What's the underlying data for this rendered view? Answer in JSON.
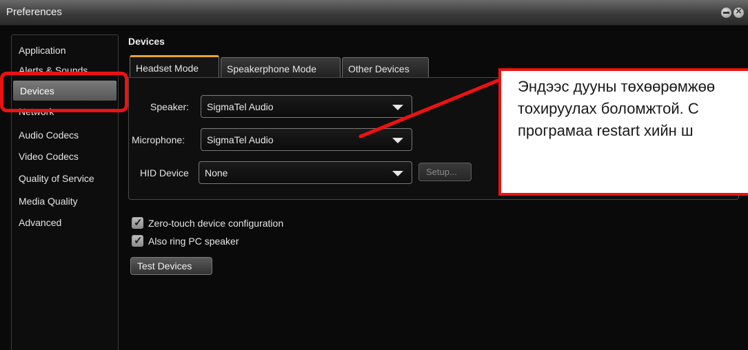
{
  "window": {
    "title": "Preferences"
  },
  "sidebar": {
    "items": [
      {
        "label": "Application"
      },
      {
        "label": "Alerts & Sounds"
      },
      {
        "label": "Devices"
      },
      {
        "label": "Network"
      },
      {
        "label": "Audio Codecs"
      },
      {
        "label": "Video Codecs"
      },
      {
        "label": "Quality of Service"
      },
      {
        "label": "Media Quality"
      },
      {
        "label": "Advanced"
      }
    ],
    "selected": "Devices"
  },
  "section": {
    "title": "Devices"
  },
  "tabs": [
    {
      "label": "Headset Mode",
      "active": true
    },
    {
      "label": "Speakerphone Mode",
      "active": false
    },
    {
      "label": "Other Devices",
      "active": false
    }
  ],
  "fields": {
    "speaker": {
      "label": "Speaker:",
      "value": "SigmaTel Audio"
    },
    "microphone": {
      "label": "Microphone:",
      "value": "SigmaTel Audio"
    },
    "hid": {
      "label": "HID Device",
      "value": "None",
      "setup_label": "Setup..."
    }
  },
  "checkboxes": [
    {
      "label": "Zero-touch device configuration",
      "checked": true
    },
    {
      "label": "Also ring PC speaker",
      "checked": true
    }
  ],
  "test_button": {
    "label": "Test Devices"
  },
  "annotation": {
    "lines": [
      "Эндээс дууны төхөөрөмжөө",
      "тохируулах боломжтой. С",
      "програмаа restart хийн ш"
    ],
    "color": "#ee1111"
  },
  "colors": {
    "accent_tab": "#e8a52a",
    "background": "#0a0a0a"
  }
}
